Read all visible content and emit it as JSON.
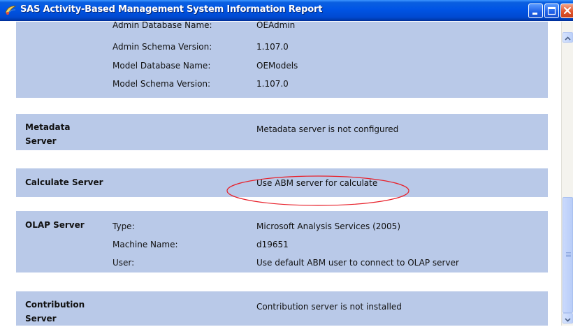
{
  "window": {
    "title": "SAS Activity-Based Management System Information Report",
    "icon": "sas-app-icon",
    "buttons": {
      "minimize": "minimize-icon",
      "maximize": "maximize-icon",
      "close": "close-icon"
    }
  },
  "colors": {
    "titlebar": "#0055e5",
    "section_background": "#b9c9e8",
    "annotation_ellipse": "#e8202a"
  },
  "database_section": {
    "rows": [
      {
        "label": "Admin Database Name:",
        "value": "OEAdmin"
      },
      {
        "label": "Admin Schema Version:",
        "value": "1.107.0"
      },
      {
        "label": "Model Database Name:",
        "value": "OEModels"
      },
      {
        "label": "Model Schema Version:",
        "value": "1.107.0"
      }
    ]
  },
  "metadata_server": {
    "header_line1": "Metadata",
    "header_line2": "Server",
    "value": "Metadata server is not configured"
  },
  "calculate_server": {
    "header": "Calculate Server",
    "value": "Use ABM server for calculate"
  },
  "olap_server": {
    "header": "OLAP Server",
    "rows": [
      {
        "label": "Type:",
        "value": "Microsoft Analysis Services (2005)"
      },
      {
        "label": "Machine Name:",
        "value": "d19651"
      },
      {
        "label": "User:",
        "value": "Use default ABM user to connect to OLAP server"
      }
    ]
  },
  "contribution_server": {
    "header_line1": "Contribution",
    "header_line2": "Server",
    "value": "Contribution server is not installed"
  },
  "scrollbar": {
    "up_icon": "scroll-up-arrow-icon",
    "down_icon": "scroll-down-arrow-icon"
  }
}
